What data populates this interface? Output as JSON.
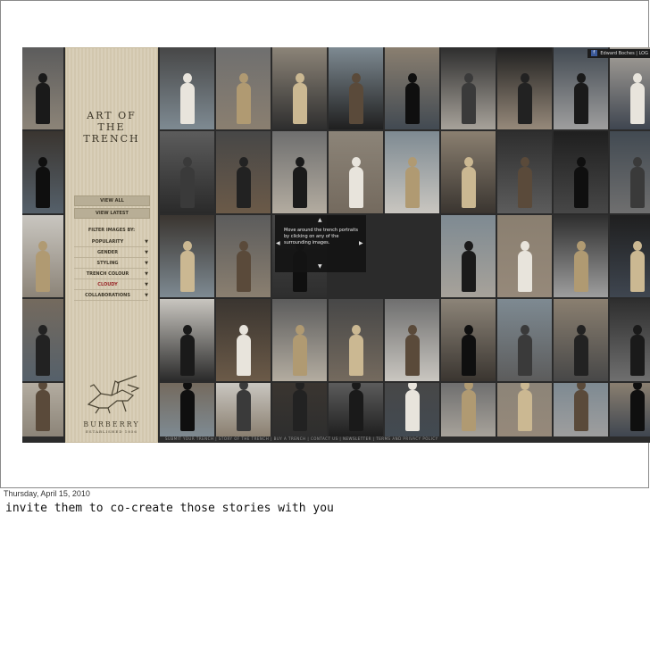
{
  "site": {
    "title_lines": [
      "ART OF",
      "THE",
      "TRENCH"
    ],
    "buttons": {
      "view_all": "VIEW ALL",
      "view_latest": "VIEW LATEST"
    },
    "filter_label": "FILTER IMAGES BY:",
    "filters": [
      {
        "label": "POPULARITY",
        "selected": false
      },
      {
        "label": "GENDER",
        "selected": false
      },
      {
        "label": "STYLING",
        "selected": false
      },
      {
        "label": "TRENCH COLOUR",
        "selected": false
      },
      {
        "label": "CLOUDY",
        "selected": true
      },
      {
        "label": "COLLABORATIONS",
        "selected": false
      }
    ],
    "brand": "BURBERRY",
    "brand_sub": "ESTABLISHED 1856",
    "crest_icon": "knight-crest-icon",
    "user": {
      "name": "Edward Boches",
      "separator": "|",
      "action": "LOG",
      "facebook_icon": "facebook-icon"
    },
    "tooltip": "Move around the trench portraits by clicking on any of the surrounding images.",
    "tooltip_arrows": {
      "up": "▲",
      "down": "▼",
      "left": "◀",
      "right": "▶"
    },
    "footer": "SUBMIT YOUR TRENCH  |  STORY OF THE TRENCH  |  BUY A TRENCH  |  CONTACT US  |  NEWSLETTER  |  TERMS AND PRIVACY POLICY",
    "dropdown_arrow": "▼"
  },
  "slide": {
    "date": "Thursday, April 15, 2010",
    "note": "invite them to co-create those stories with you"
  },
  "photos": {
    "palette": [
      "#5c5c5c",
      "#8c8478",
      "#2e2e2e",
      "#a7a29a",
      "#3f4650",
      "#6b5a48",
      "#c9c6c0",
      "#474747",
      "#7e8a92",
      "#1f1f1f",
      "#96897a",
      "#55606a",
      "#b3aca0",
      "#3a3530",
      "#6f6f6f",
      "#8a7f70",
      "#424a52",
      "#9e9e9e",
      "#2a2a2a",
      "#746a5e"
    ],
    "figure_tones": [
      "#1a1a1a",
      "#cbb892",
      "#3a3a3a",
      "#e8e4dc",
      "#5a4a3a",
      "#222",
      "#b09a72",
      "#0f0f0f"
    ]
  }
}
